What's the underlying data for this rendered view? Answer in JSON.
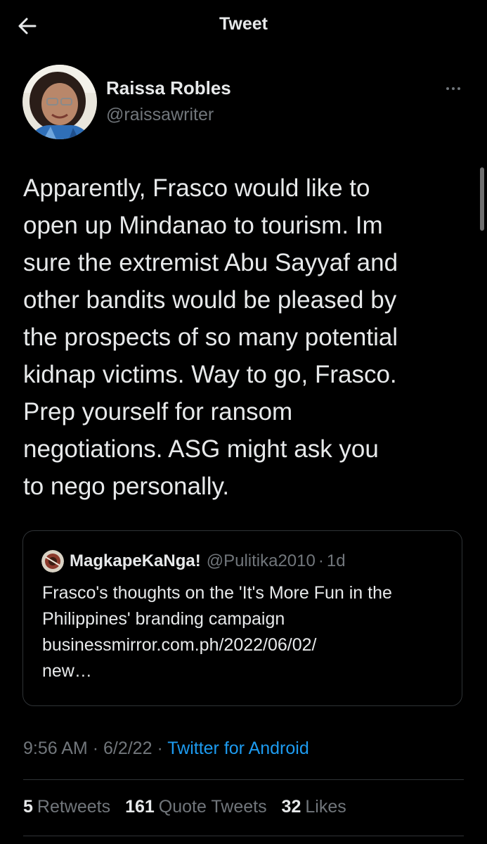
{
  "header": {
    "title": "Tweet",
    "back_icon": "arrow-left-icon"
  },
  "author": {
    "name": "Raissa Robles",
    "handle": "@raissawriter",
    "more_icon": "more-horizontal-icon"
  },
  "tweet": {
    "text": "Apparently, Frasco would like to\nopen up Mindanao to tourism. Im\nsure the extremist Abu Sayyaf and\nother bandits would be pleased by\nthe prospects of so many potential\nkidnap victims. Way to go, Frasco.\nPrep yourself for ransom\nnegotiations. ASG might ask you\nto nego personally."
  },
  "quoted_tweet": {
    "name": "MagkapeKaNga!",
    "handle": "@Pulitika2010",
    "separator": "·",
    "time": "1d",
    "text": "Frasco's thoughts on the 'It's More Fun in the Philippines' branding campaign businessmirror.com.ph/2022/06/02/\nnew…"
  },
  "meta": {
    "time": "9:56 AM",
    "separator": "·",
    "date": "6/2/22",
    "source": "Twitter for Android"
  },
  "stats": {
    "retweets_count": "5",
    "retweets_label": "Retweets",
    "quotes_count": "161",
    "quotes_label": "Quote Tweets",
    "likes_count": "32",
    "likes_label": "Likes"
  },
  "colors": {
    "background": "#000000",
    "text": "#e7e9ea",
    "secondary_text": "#71767b",
    "link": "#1d9bf0",
    "border": "#2f3336"
  }
}
